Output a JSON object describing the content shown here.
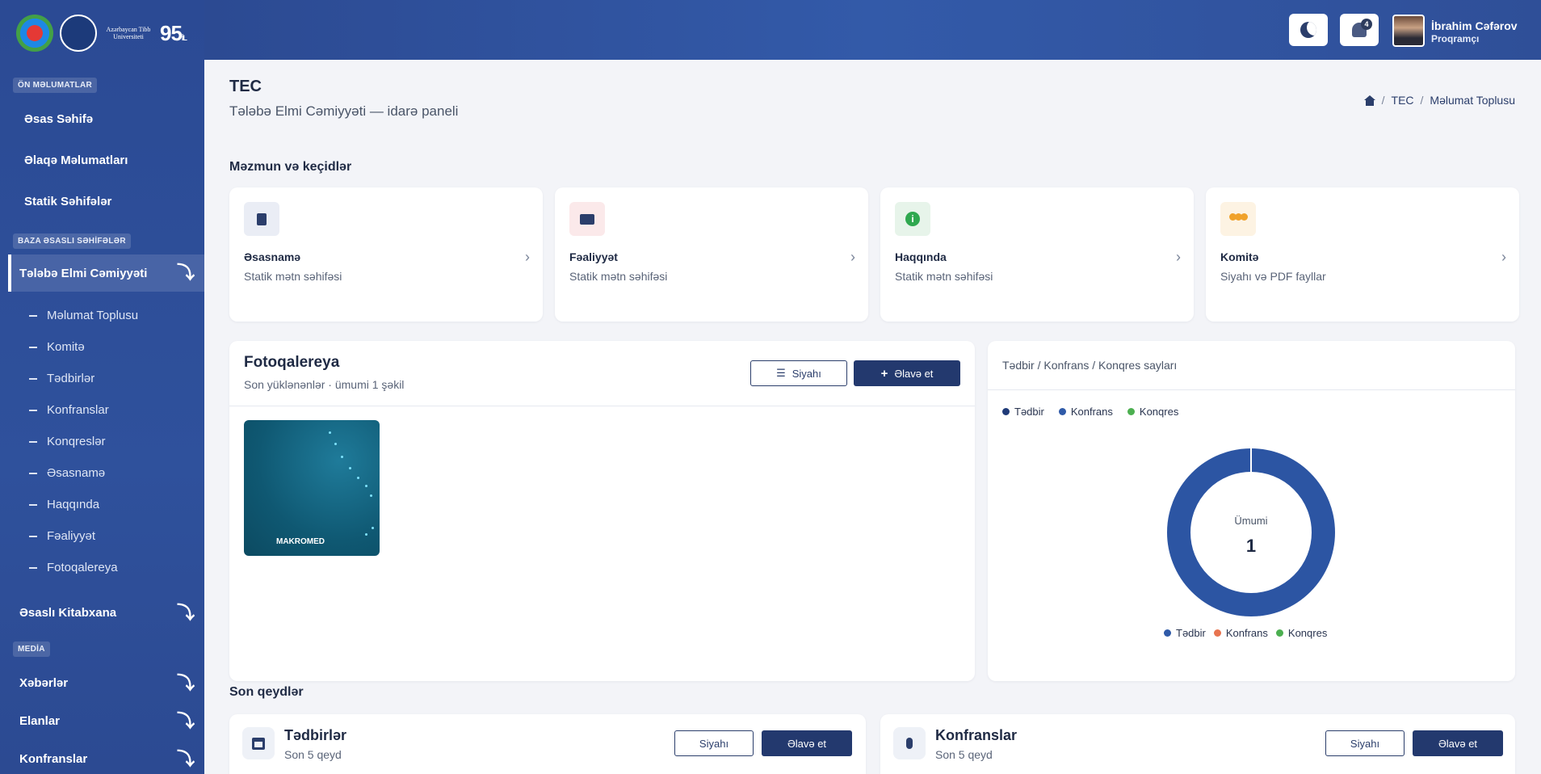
{
  "logo": {
    "university_text": "Azərbaycan Tibb Universiteti",
    "anniversary": "95",
    "anniversary_suffix": "İL"
  },
  "sidebar": {
    "section1": "ÖN MƏLUMATLAR",
    "items1": [
      "Əsas Səhifə",
      "Əlaqə Məlumatları",
      "Statik Səhifələr"
    ],
    "section2": "BAZA ƏSASLI SƏHİFƏLƏR",
    "active_parent": "Tələbə Elmi Cəmiyyəti",
    "sub_items": [
      "Məlumat Toplusu",
      "Komitə",
      "Tədbirlər",
      "Konfranslar",
      "Konqreslər",
      "Əsasnamə",
      "Haqqında",
      "Fəaliyyət",
      "Fotoqalereya"
    ],
    "parent2": "Əsaslı Kitabxana",
    "section3": "MEDİA",
    "media_items": [
      "Xəbərlər",
      "Elanlar",
      "Konfranslar"
    ]
  },
  "topbar": {
    "notifications_count": "4",
    "user_name": "İbrahim Cəfərov",
    "user_role": "Proqramçı"
  },
  "header": {
    "title": "TEC",
    "subtitle": "Tələbə Elmi Cəmiyyəti — idarə paneli",
    "breadcrumb": [
      "TEC",
      "Məlumat Toplusu"
    ]
  },
  "links_section": {
    "title": "Məzmun və keçidlər",
    "cards": [
      {
        "title": "Əsasnamə",
        "subtitle": "Statik mətn səhifəsi",
        "icon": "document-icon"
      },
      {
        "title": "Fəaliyyət",
        "subtitle": "Statik mətn səhifəsi",
        "icon": "briefcase-icon"
      },
      {
        "title": "Haqqında",
        "subtitle": "Statik mətn səhifəsi",
        "icon": "info-icon"
      },
      {
        "title": "Komitə",
        "subtitle": "Siyahı və PDF fayllar",
        "icon": "users-icon"
      }
    ]
  },
  "gallery": {
    "title": "Fotoqalereya",
    "subtitle": "Son yüklənənlər · ümumi 1 şəkil",
    "list_btn": "Siyahı",
    "add_btn": "Əlavə et",
    "thumb_label": "MAKROMED"
  },
  "chart_card": {
    "title": "Tədbir / Konfrans / Konqres sayları",
    "center_label": "Ümumi",
    "center_value": "1"
  },
  "chart_data": {
    "type": "pie",
    "categories": [
      "Tədbir",
      "Konfrans",
      "Konqres"
    ],
    "values": [
      1,
      0,
      0
    ],
    "top_legend_colors": [
      "#1f3a78",
      "#2f5aa8",
      "#4caf50"
    ],
    "bottom_legend_colors": [
      "#2f5aa8",
      "#e8744f",
      "#4caf50"
    ],
    "ring_color": "#2c55a3"
  },
  "recent": {
    "title": "Son qeydlər",
    "cards": [
      {
        "title": "Tədbirlər",
        "subtitle": "Son 5 qeyd",
        "list_btn": "Siyahı",
        "add_btn": "Əlavə et"
      },
      {
        "title": "Konfranslar",
        "subtitle": "Son 5 qeyd",
        "list_btn": "Siyahı",
        "add_btn": "Əlavə et"
      }
    ]
  }
}
